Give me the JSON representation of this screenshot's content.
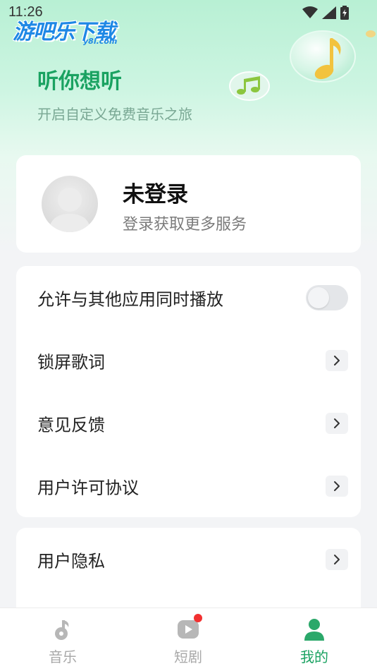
{
  "status_bar": {
    "time": "11:26",
    "icons": [
      "wifi-icon",
      "signal-icon",
      "battery-icon"
    ]
  },
  "watermark": {
    "text": "游吧乐下载",
    "sub": "y8l.com"
  },
  "hero": {
    "title": "听你想听",
    "subtitle": "开启自定义免费音乐之旅"
  },
  "login": {
    "title": "未登录",
    "subtitle": "登录获取更多服务"
  },
  "settings": {
    "items": [
      {
        "label": "允许与其他应用同时播放",
        "control": "toggle",
        "enabled": false
      },
      {
        "label": "锁屏歌词",
        "control": "chevron"
      },
      {
        "label": "意见反馈",
        "control": "chevron"
      },
      {
        "label": "用户许可协议",
        "control": "chevron"
      }
    ],
    "items2": [
      {
        "label": "用户隐私",
        "control": "chevron"
      }
    ]
  },
  "tabbar": {
    "tabs": [
      {
        "label": "音乐",
        "icon": "music-note-icon",
        "active": false
      },
      {
        "label": "短剧",
        "icon": "video-play-icon",
        "active": false,
        "badge": true
      },
      {
        "label": "我的",
        "icon": "user-icon",
        "active": true
      }
    ]
  },
  "colors": {
    "accent": "#1aa261",
    "hero_gradient_top": "#b8f0d4",
    "badge": "#f23030",
    "inactive": "#a9a9a9"
  }
}
